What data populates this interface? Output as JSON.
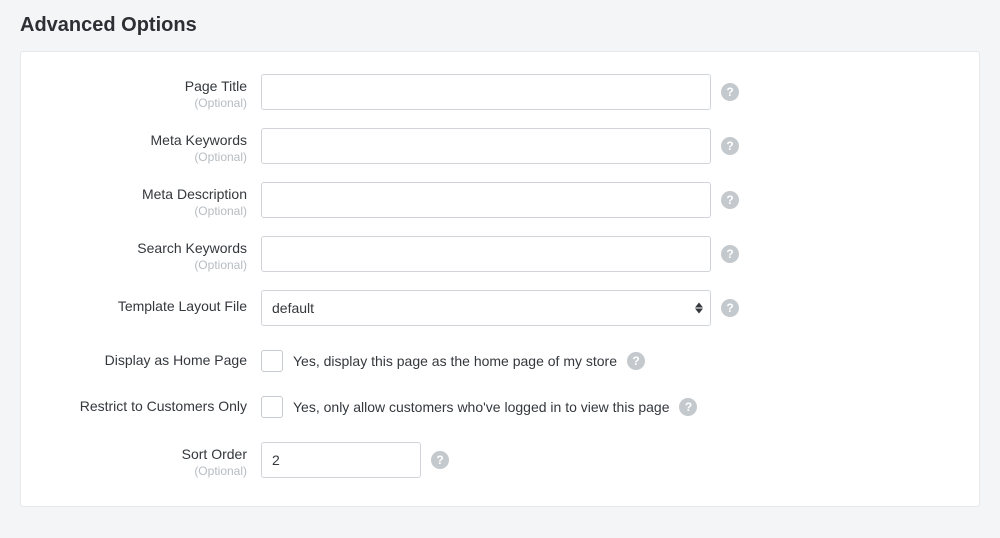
{
  "section": {
    "title": "Advanced Options"
  },
  "labels": {
    "optional": "(Optional)",
    "pageTitle": "Page Title",
    "metaKeywords": "Meta Keywords",
    "metaDescription": "Meta Description",
    "searchKeywords": "Search Keywords",
    "templateLayoutFile": "Template Layout File",
    "displayAsHomePage": "Display as Home Page",
    "restrictToCustomers": "Restrict to Customers Only",
    "sortOrder": "Sort Order"
  },
  "fields": {
    "pageTitle": "",
    "metaKeywords": "",
    "metaDescription": "",
    "searchKeywords": "",
    "templateLayoutFile": "default",
    "displayAsHomePageText": "Yes, display this page as the home page of my store",
    "restrictToCustomersText": "Yes, only allow customers who've logged in to view this page",
    "sortOrder": "2"
  },
  "help": {
    "glyph": "?"
  }
}
